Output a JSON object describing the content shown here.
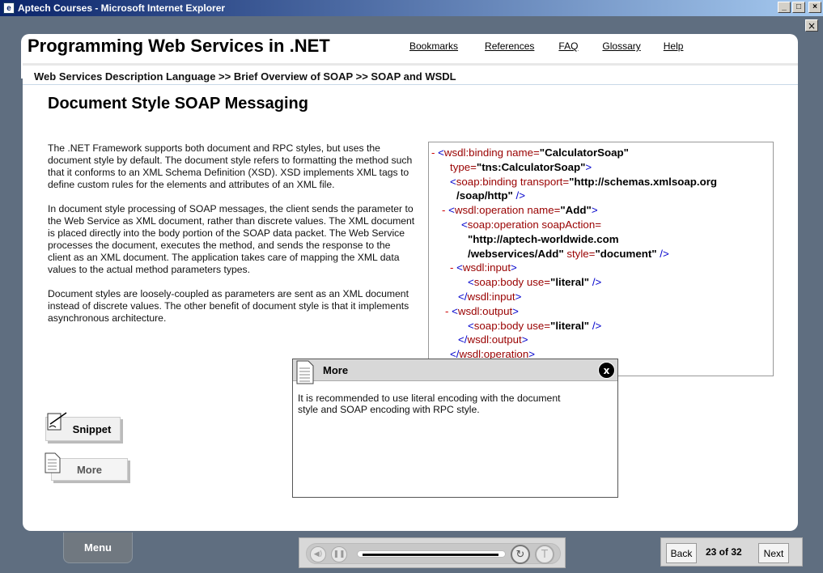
{
  "window": {
    "title": "Aptech Courses - Microsoft Internet Explorer",
    "min": "_",
    "max": "□",
    "close": "×"
  },
  "header": {
    "course_title": "Programming Web Services in .NET",
    "nav": [
      "Bookmarks",
      "References",
      "FAQ",
      "Glossary",
      "Help"
    ]
  },
  "breadcrumb": "Web Services Description Language >> Brief Overview of SOAP >> SOAP and WSDL",
  "page": {
    "title": "Document Style SOAP Messaging",
    "paragraphs": [
      "The .NET Framework supports both document and RPC styles, but uses the document style by default. The document style refers to formatting the method such that it conforms to an XML Schema Definition (XSD). XSD implements XML tags to define custom rules for the elements and attributes of an XML file.",
      "In document style processing of SOAP messages, the client sends the parameter to the Web Service as XML document, rather than discrete values. The XML document is placed directly into the body portion of the SOAP data packet. The Web Service processes the document, executes the method, and sends the response to the client as an XML document. The application takes care of mapping the XML data values to the actual method parameters types.",
      "Document styles are loosely-coupled as parameters are sent as an XML document instead of discrete values. The other benefit of document style is that it implements asynchronous architecture."
    ]
  },
  "code": {
    "l1_tag": "wsdl:binding name=",
    "l1_val": "\"CalculatorSoap\"",
    "l2_tag": "type=",
    "l2_val": "\"tns:CalculatorSoap\"",
    "l3_tag": "soap:binding transport=",
    "l3_val": "\"http://schemas.xmlsoap.org",
    "l4_val": "/soap/http\"",
    "l5_tag": "wsdl:operation name=",
    "l5_val": "\"Add\"",
    "l6_tag": "soap:operation soapAction=",
    "l7_val": "\"http://aptech-worldwide.com",
    "l8_val": "/webservices/Add\"",
    "l8_tag": " style=",
    "l8_val2": "\"document\"",
    "l9_tag": "wsdl:input",
    "l10_tag": "soap:body use=",
    "l10_val": "\"literal\"",
    "l11_tag": "wsdl:input",
    "l12_tag": "wsdl:output",
    "l13_tag": "soap:body use=",
    "l13_val": "\"literal\"",
    "l14_tag": "wsdl:output",
    "l15_tag": "wsdl:operation"
  },
  "side_buttons": {
    "snippet": "Snippet",
    "more": "More"
  },
  "popup": {
    "title": "More",
    "close": "x",
    "body": "It is recommended to use literal encoding with the document style and SOAP encoding with RPC style."
  },
  "footer": {
    "menu": "Menu",
    "back": "Back",
    "page": "23 of 32",
    "next": "Next",
    "progress": 1.0
  }
}
